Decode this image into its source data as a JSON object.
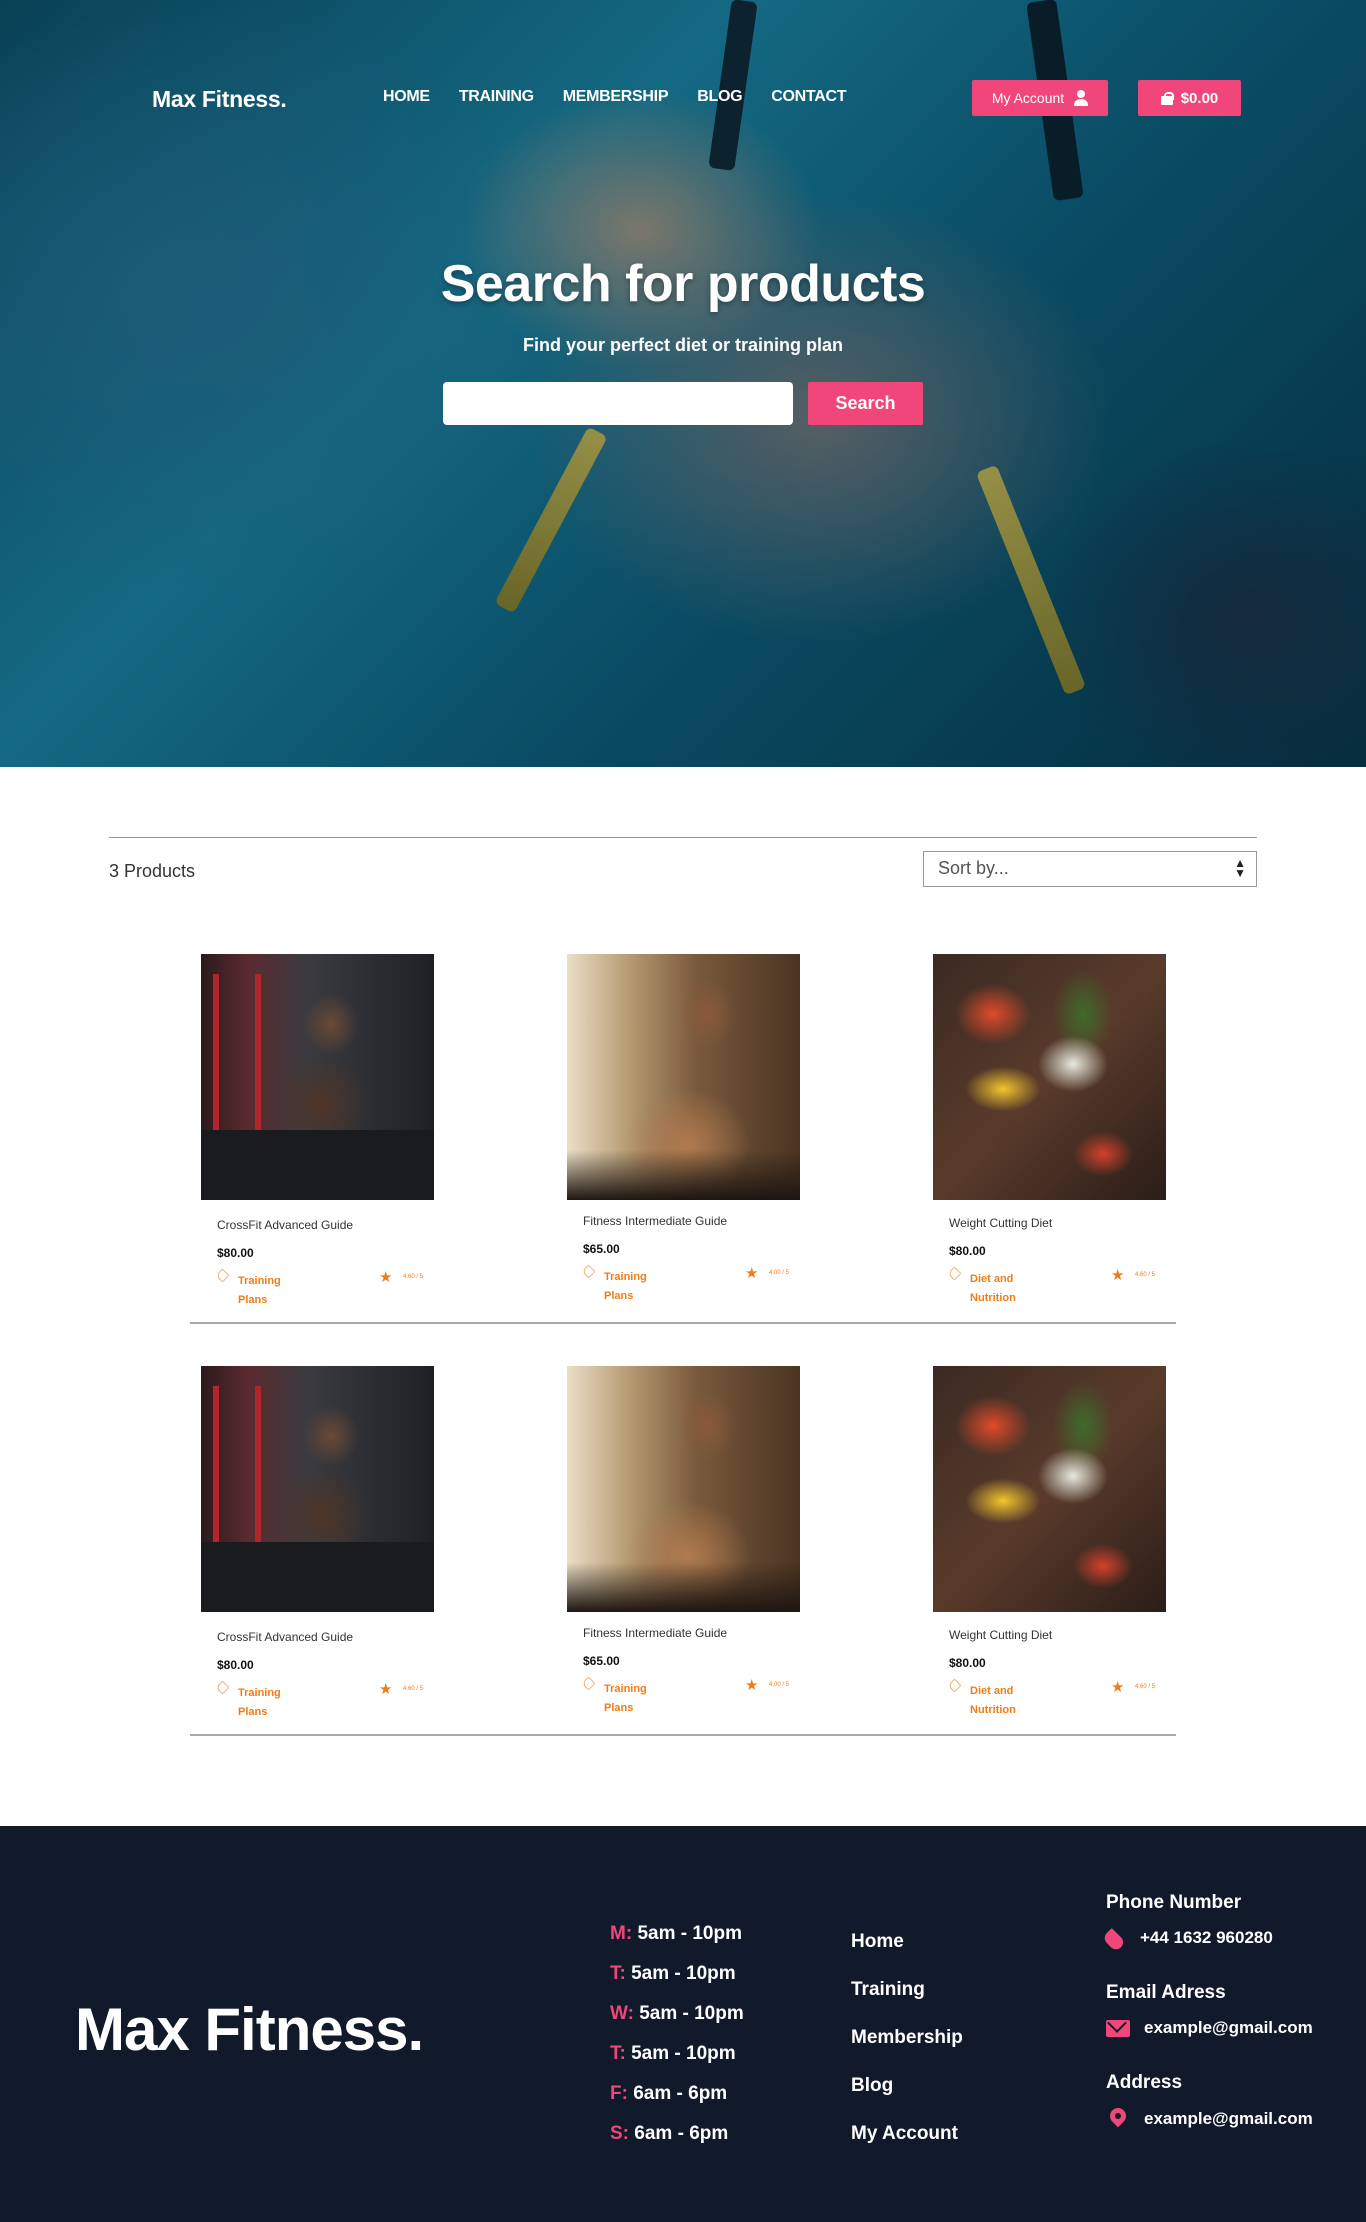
{
  "brand": {
    "logo": "Max Fitness."
  },
  "nav": {
    "items": [
      {
        "label": "HOME"
      },
      {
        "label": "TRAINING"
      },
      {
        "label": "MEMBERSHIP"
      },
      {
        "label": "BLOG"
      },
      {
        "label": "CONTACT"
      }
    ],
    "account_label": "My Account",
    "cart_total": "$0.00"
  },
  "hero": {
    "title": "Search for products",
    "subtitle": "Find your perfect diet or training plan",
    "search_value": "",
    "search_button": "Search"
  },
  "toolbar": {
    "count": "3 Products",
    "sort_selected": "Sort by..."
  },
  "products": [
    {
      "title": "CrossFit Advanced Guide",
      "price": "$80.00",
      "category_1": "Training",
      "category_2": "Plans",
      "rating": "4.60 / 5"
    },
    {
      "title": "Fitness Intermediate Guide",
      "price": "$65.00",
      "category_1": "Training",
      "category_2": "Plans",
      "rating": "4.00 / 5"
    },
    {
      "title": "Weight Cutting Diet",
      "price": "$80.00",
      "category_1": "Diet and",
      "category_2": "Nutrition",
      "rating": "4.60 / 5"
    },
    {
      "title": "CrossFit Advanced Guide",
      "price": "$80.00",
      "category_1": "Training",
      "category_2": "Plans",
      "rating": "4.60 / 5"
    },
    {
      "title": "Fitness Intermediate Guide",
      "price": "$65.00",
      "category_1": "Training",
      "category_2": "Plans",
      "rating": "4.00 / 5"
    },
    {
      "title": "Weight Cutting Diet",
      "price": "$80.00",
      "category_1": "Diet and",
      "category_2": "Nutrition",
      "rating": "4.60 / 5"
    }
  ],
  "footer": {
    "logo": "Max Fitness.",
    "hours": [
      {
        "day": "M:",
        "time": "5am - 10pm"
      },
      {
        "day": "T:",
        "time": "5am - 10pm"
      },
      {
        "day": "W:",
        "time": "5am - 10pm"
      },
      {
        "day": "T:",
        "time": "5am - 10pm"
      },
      {
        "day": "F:",
        "time": "6am - 6pm"
      },
      {
        "day": "S:",
        "time": "6am - 6pm"
      }
    ],
    "links": [
      {
        "label": "Home"
      },
      {
        "label": "Training"
      },
      {
        "label": "Membership"
      },
      {
        "label": "Blog"
      },
      {
        "label": "My Account"
      }
    ],
    "phone_heading": "Phone Number",
    "phone": "+44 1632 960280",
    "email_heading": "Email Adress",
    "email": "example@gmail.com",
    "address_heading": "Address",
    "address": "example@gmail.com"
  },
  "colors": {
    "accent": "#f0467a",
    "orange": "#ef7d16",
    "footer_bg": "#111a2a"
  },
  "icons": [
    "person-icon",
    "bag-icon",
    "tag-icon",
    "star-icon",
    "phone-icon",
    "mail-icon",
    "pin-icon"
  ]
}
